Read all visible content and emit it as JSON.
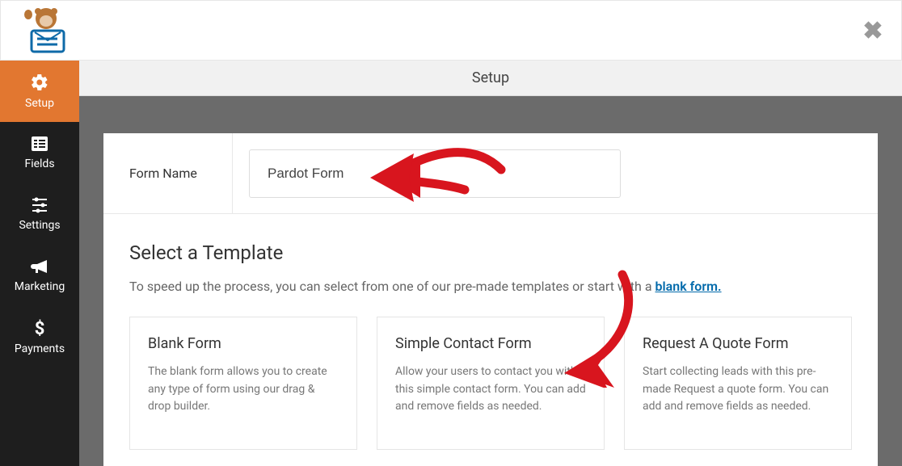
{
  "header": {
    "title": "Setup"
  },
  "sidebar": {
    "items": [
      {
        "label": "Setup"
      },
      {
        "label": "Fields"
      },
      {
        "label": "Settings"
      },
      {
        "label": "Marketing"
      },
      {
        "label": "Payments"
      }
    ]
  },
  "form": {
    "name_label": "Form Name",
    "name_value": "Pardot Form"
  },
  "template": {
    "heading": "Select a Template",
    "lead_pre": "To speed up the process, you can select from one of our pre-made templates or start with a ",
    "lead_link": "blank form."
  },
  "cards": [
    {
      "title": "Blank Form",
      "desc": "The blank form allows you to create any type of form using our drag & drop builder."
    },
    {
      "title": "Simple Contact Form",
      "desc": "Allow your users to contact you with this simple contact form. You can add and remove fields as needed."
    },
    {
      "title": "Request A Quote Form",
      "desc": "Start collecting leads with this pre-made Request a quote form. You can add and remove fields as needed."
    }
  ]
}
